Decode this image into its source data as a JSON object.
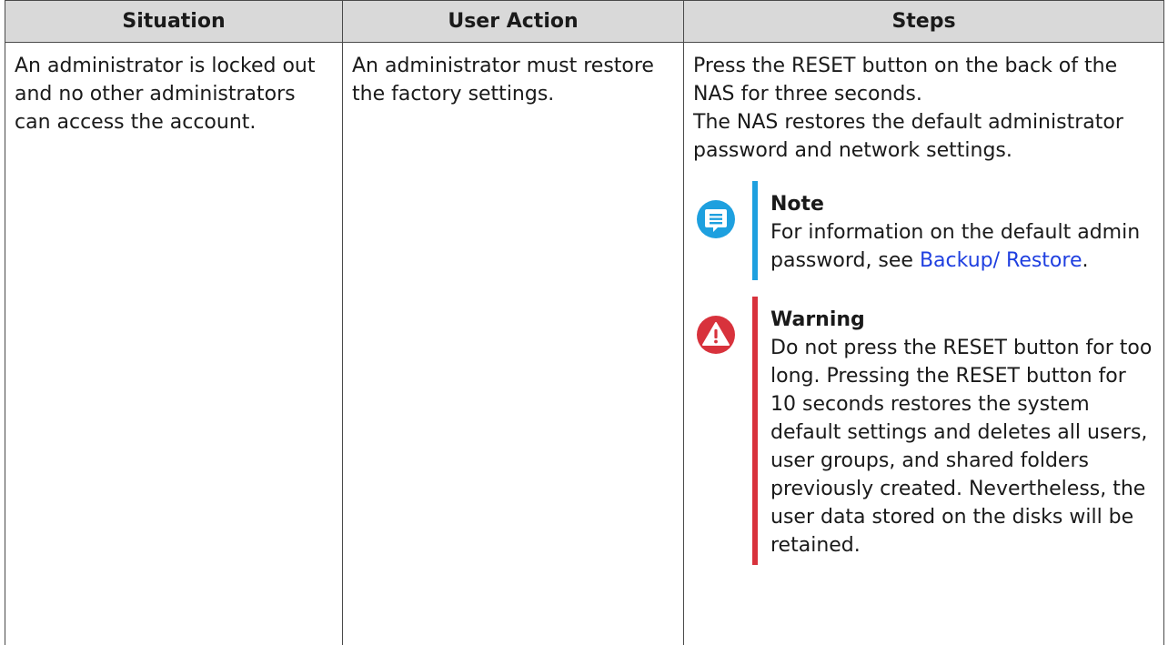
{
  "table": {
    "headers": {
      "situation": "Situation",
      "user_action": "User Action",
      "steps": "Steps"
    },
    "row": {
      "situation": "An administrator is locked out and no other administrators can access the account.",
      "user_action": "An administrator must restore the factory settings.",
      "steps_line1": "Press the RESET button on the back of the NAS for three seconds.",
      "steps_line2": "The NAS restores the default administrator password and network settings."
    }
  },
  "note": {
    "icon": "note-icon",
    "color": "#1ea0df",
    "title": "Note",
    "text_before_link": "For information on the default admin password, see ",
    "link_text": "Backup/ Restore",
    "text_after_link": "."
  },
  "warning": {
    "icon": "warning-icon",
    "color": "#d8323c",
    "title": "Warning",
    "text": "Do not press the RESET button for too long. Pressing the RESET button for 10 seconds restores the system default settings and deletes all users, user groups, and shared folders previously created. Nevertheless, the user data stored on the disks will be retained."
  }
}
